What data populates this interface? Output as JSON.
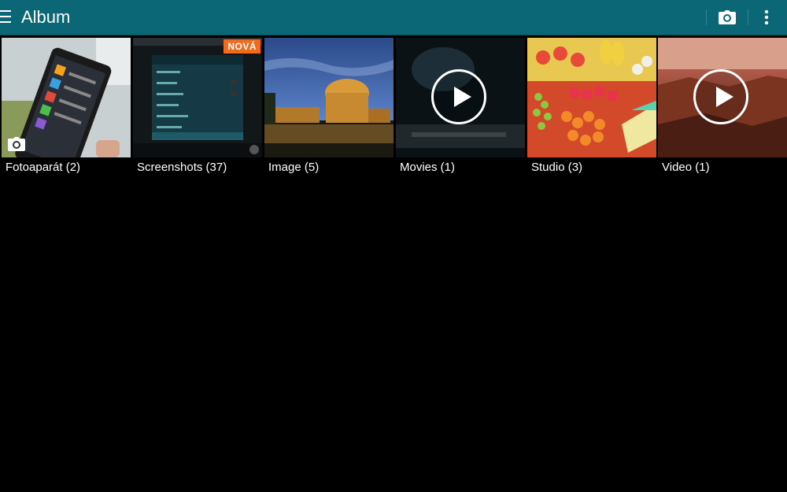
{
  "app": {
    "title": "Album"
  },
  "toolbar": {
    "camera_icon": "camera-icon",
    "more_icon": "more-vert-icon",
    "menu_icon": "menu-icon"
  },
  "albums": [
    {
      "label": "Fotoaparát (2)",
      "kind": "camera"
    },
    {
      "label": "Screenshots (37)",
      "kind": "screenshots",
      "badge": "NOVÁ"
    },
    {
      "label": "Image (5)",
      "kind": "image"
    },
    {
      "label": "Movies (1)",
      "kind": "video"
    },
    {
      "label": "Studio (3)",
      "kind": "image"
    },
    {
      "label": "Video (1)",
      "kind": "video"
    }
  ],
  "colors": {
    "appbar": "#0b6676",
    "badge": "#f26b1d",
    "background": "#000000"
  }
}
